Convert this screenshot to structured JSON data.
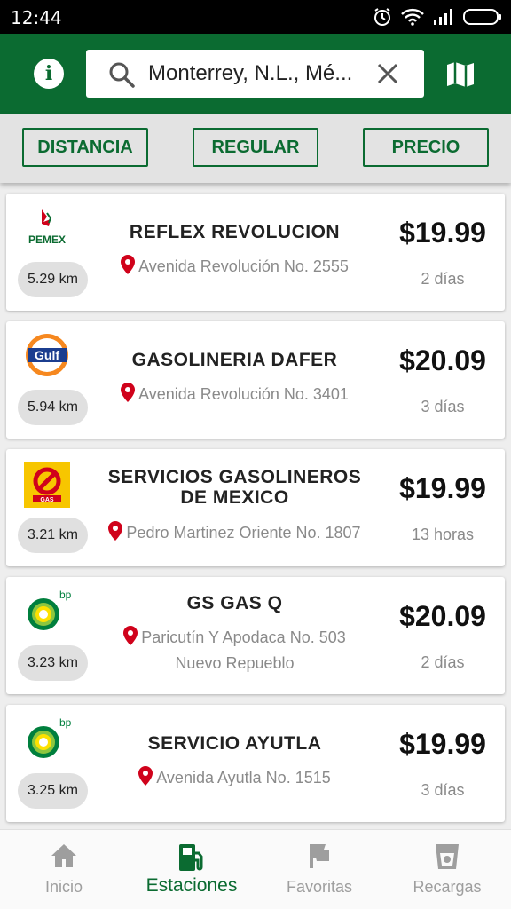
{
  "status": {
    "time": "12:44"
  },
  "search": {
    "value": "Monterrey, N.L., Mé..."
  },
  "filters": [
    "DISTANCIA",
    "REGULAR",
    "PRECIO"
  ],
  "stations": [
    {
      "brand": "PEMEX",
      "name": "REFLEX REVOLUCION",
      "address": "Avenida Revolución No. 2555",
      "distance": "5.29 km",
      "price": "$19.99",
      "age": "2 días"
    },
    {
      "brand": "Gulf",
      "name": "GASOLINERIA DAFER",
      "address": "Avenida Revolución No. 3401",
      "distance": "5.94 km",
      "price": "$20.09",
      "age": "3 días"
    },
    {
      "brand": "GAS",
      "name": "SERVICIOS GASOLINEROS DE MEXICO",
      "address": "Pedro Martinez Oriente No. 1807",
      "distance": "3.21 km",
      "price": "$19.99",
      "age": "13 horas"
    },
    {
      "brand": "bp",
      "name": "GS GAS Q",
      "address": "Paricutín Y Apodaca No. 503",
      "address2": "Nuevo Repueblo",
      "distance": "3.23 km",
      "price": "$20.09",
      "age": "2 días"
    },
    {
      "brand": "bp",
      "name": "SERVICIO AYUTLA",
      "address": "Avenida Ayutla No. 1515",
      "distance": "3.25 km",
      "price": "$19.99",
      "age": "3 días"
    }
  ],
  "nav": [
    {
      "label": "Inicio",
      "icon": "home-icon"
    },
    {
      "label": "Estaciones",
      "icon": "gas-station-icon",
      "active": true
    },
    {
      "label": "Favoritas",
      "icon": "flag-icon"
    },
    {
      "label": "Recargas",
      "icon": "cup-icon"
    }
  ],
  "colors": {
    "primary": "#0b6b31",
    "pin": "#d0021b"
  }
}
